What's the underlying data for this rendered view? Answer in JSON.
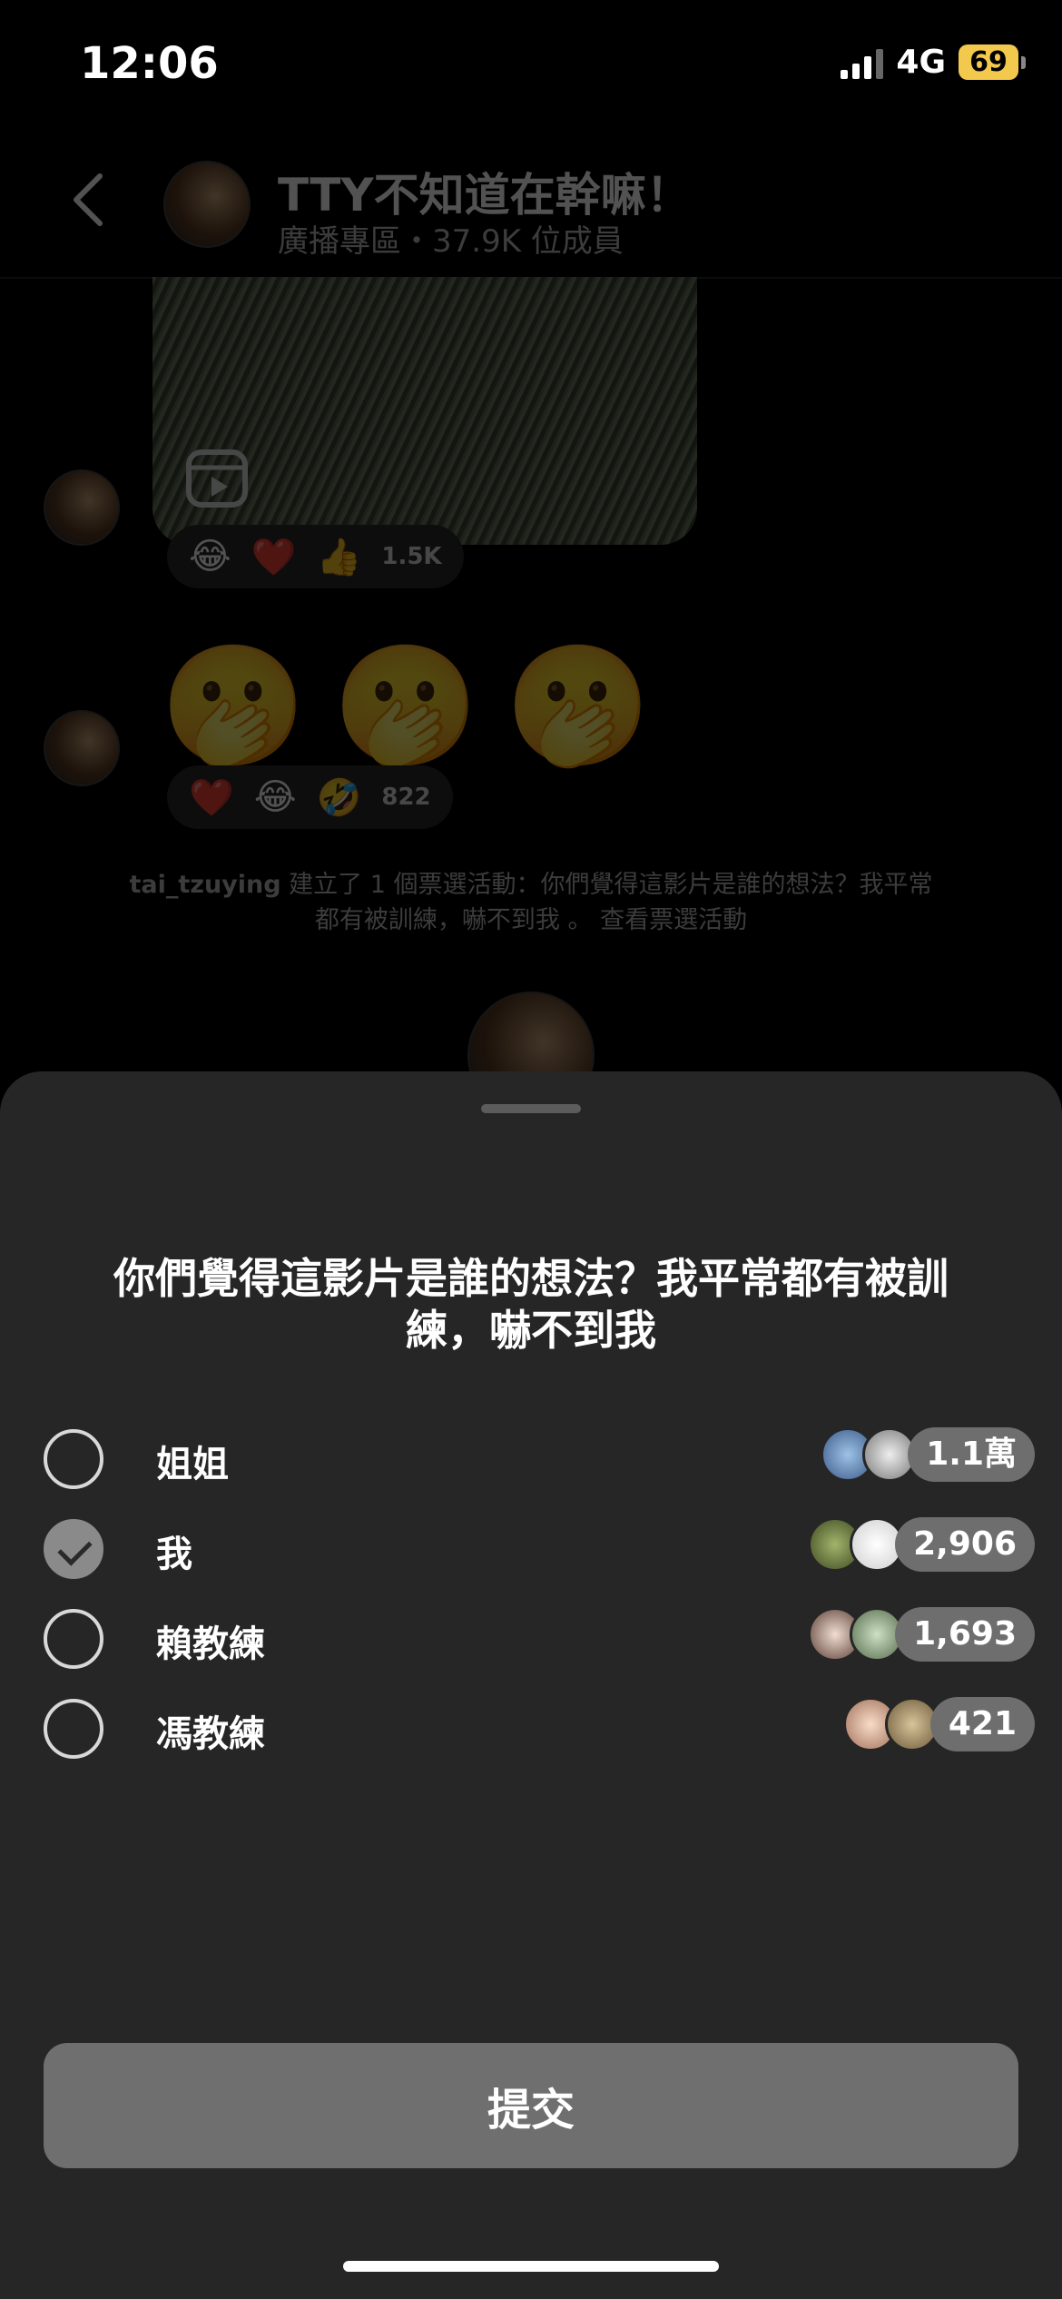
{
  "status": {
    "time": "12:06",
    "network": "4G",
    "battery": "69"
  },
  "channel": {
    "title": "TTY不知道在幹嘛！",
    "subtitle": "廣播專區・37.9K 位成員"
  },
  "messages": {
    "video_reactions": {
      "emojis": [
        "😂",
        "❤️",
        "👍"
      ],
      "count": "1.5K"
    },
    "emoji_message": [
      "🫢",
      "🫢",
      "🫢"
    ],
    "emoji_reactions": {
      "emojis": [
        "❤️",
        "😂",
        "🤣"
      ],
      "count": "822"
    },
    "system": {
      "user": "tai_tzuying",
      "text": " 建立了 1 個票選活動：你們覺得這影片是誰的想法？我平常都有被訓練，嚇不到我 。",
      "link": " 查看票選活動"
    }
  },
  "poll": {
    "question": "你們覺得這影片是誰的想法？我平常都有被訓練，嚇不到我",
    "options": [
      {
        "label": "姐姐",
        "count": "1.1萬",
        "selected": false
      },
      {
        "label": "我",
        "count": "2,906",
        "selected": true
      },
      {
        "label": "賴教練",
        "count": "1,693",
        "selected": false
      },
      {
        "label": "馮教練",
        "count": "421",
        "selected": false
      }
    ],
    "submit_label": "提交"
  },
  "icons": [
    "back-chevron-icon",
    "reel-icon",
    "checkmark-icon"
  ]
}
